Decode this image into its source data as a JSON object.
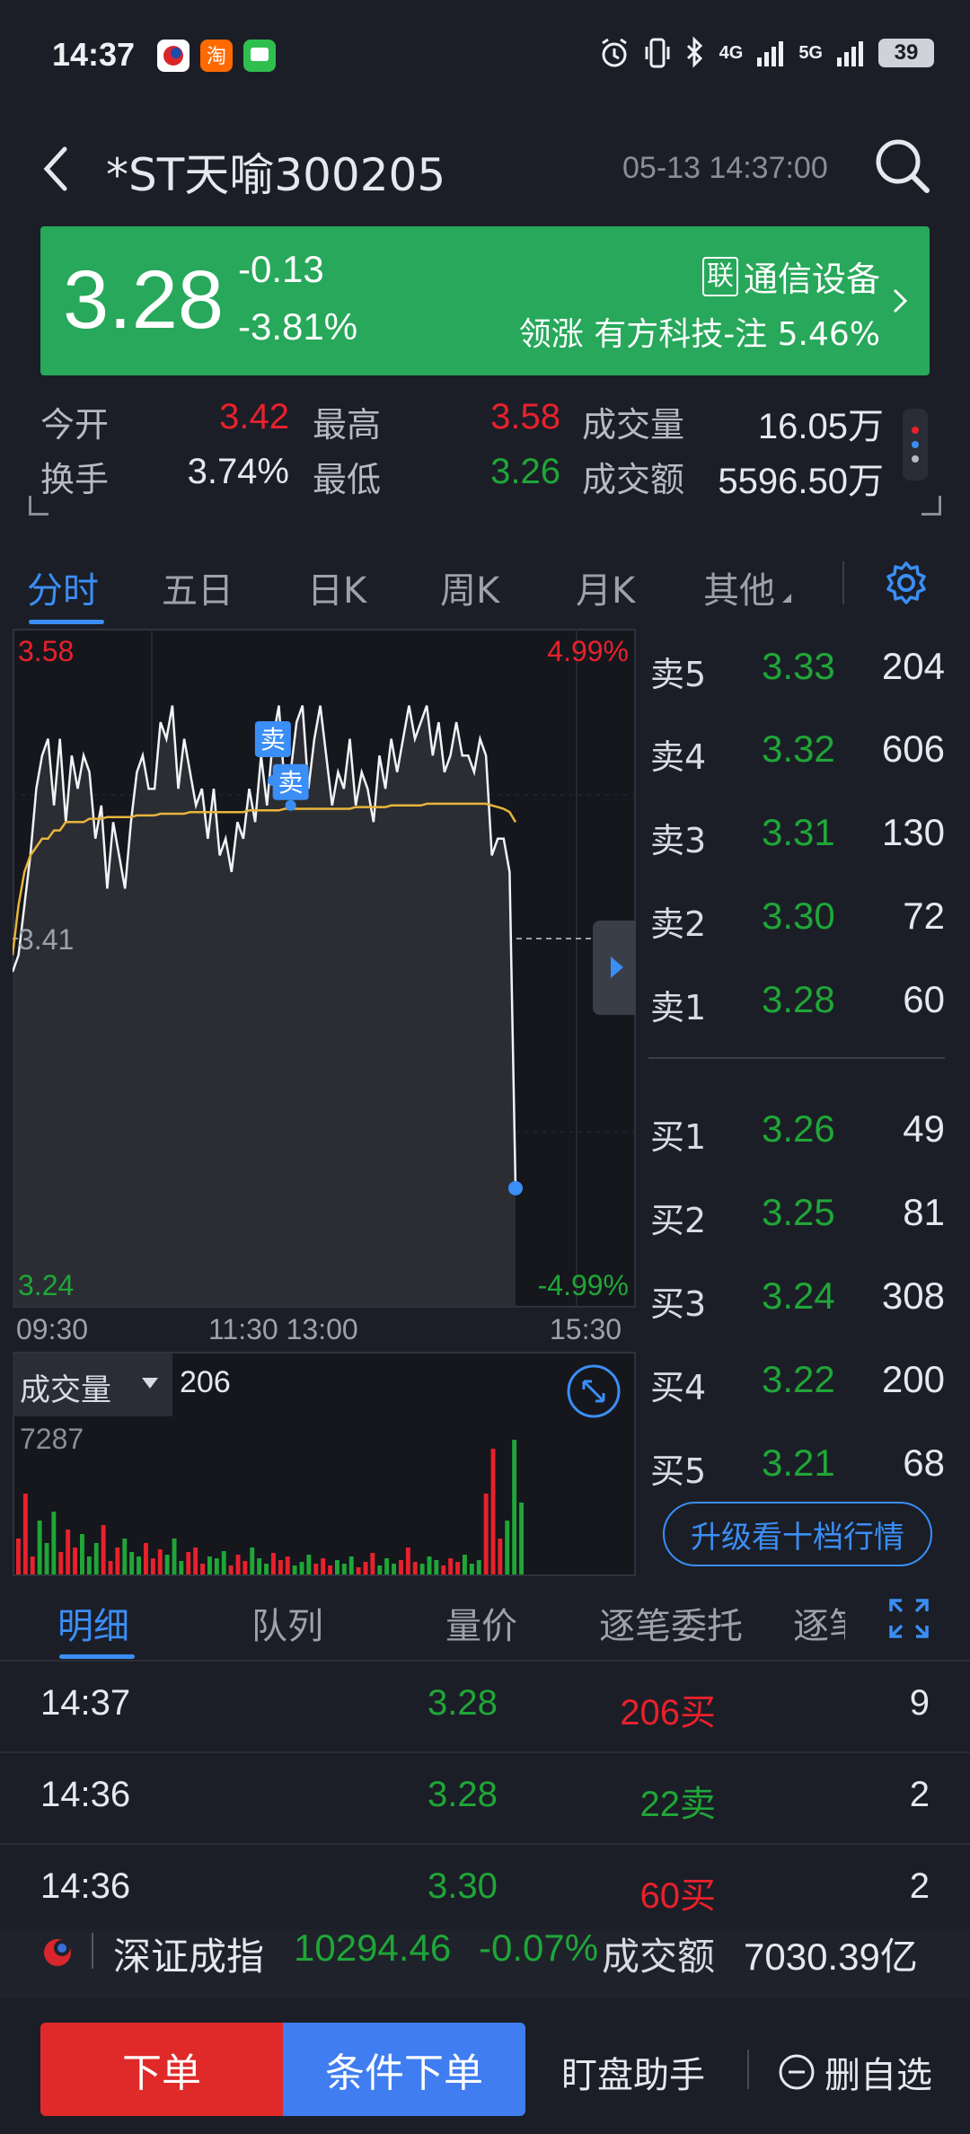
{
  "status_bar": {
    "time": "14:37",
    "battery": "39",
    "network_1": "4G",
    "network_2": "5G"
  },
  "header": {
    "title": "*ST天喻300205",
    "datetime": "05-13 14:37:00"
  },
  "banner": {
    "price": "3.28",
    "change": "-0.13",
    "change_pct": "-3.81%",
    "industry_tag": "联",
    "industry": "通信设备",
    "leader": "领涨 有方科技-注 5.46%"
  },
  "stats": {
    "open_label": "今开",
    "open": "3.42",
    "high_label": "最高",
    "high": "3.58",
    "volume_label": "成交量",
    "volume": "16.05万",
    "turnover_label": "换手",
    "turnover": "3.74%",
    "low_label": "最低",
    "low": "3.26",
    "amount_label": "成交额",
    "amount": "5596.50万"
  },
  "tabs": [
    "分时",
    "五日",
    "日K",
    "周K",
    "月K",
    "其他"
  ],
  "chart_data": {
    "type": "line",
    "title": "",
    "y_top_label": "3.58",
    "y_bottom_label": "3.24",
    "y_mid_label": "3.41",
    "pct_top": "4.99%",
    "pct_bottom": "-4.99%",
    "ylim": [
      3.24,
      3.58
    ],
    "prev_close": 3.41,
    "x_labels": [
      "09:30",
      "11:30 13:00",
      "15:30"
    ],
    "series": [
      {
        "values": [
          3.39,
          3.4,
          3.43,
          3.46,
          3.5,
          3.52,
          3.53,
          3.49,
          3.53,
          3.48,
          3.52,
          3.5,
          3.52,
          3.51,
          3.47,
          3.49,
          3.44,
          3.48,
          3.46,
          3.44,
          3.48,
          3.51,
          3.52,
          3.5,
          3.5,
          3.54,
          3.53,
          3.55,
          3.5,
          3.53,
          3.51,
          3.49,
          3.5,
          3.47,
          3.5,
          3.46,
          3.47,
          3.45,
          3.48,
          3.47,
          3.5,
          3.48,
          3.52,
          3.49,
          3.53,
          3.55,
          3.5,
          3.51,
          3.54,
          3.55,
          3.5,
          3.53,
          3.55,
          3.52,
          3.49,
          3.51,
          3.5,
          3.53,
          3.49,
          3.51,
          3.5,
          3.48,
          3.52,
          3.5,
          3.53,
          3.51,
          3.53,
          3.55,
          3.53,
          3.54,
          3.55,
          3.52,
          3.54,
          3.51,
          3.52,
          3.54,
          3.52,
          3.52,
          3.51,
          3.53,
          3.52,
          3.46,
          3.47,
          3.47,
          3.45,
          3.26
        ]
      },
      {
        "values": [
          3.4,
          3.43,
          3.45,
          3.46,
          3.465,
          3.47,
          3.47,
          3.475,
          3.475,
          3.48,
          3.48,
          3.48,
          3.48,
          3.482,
          3.482,
          3.482,
          3.483,
          3.483,
          3.483,
          3.483,
          3.483,
          3.484,
          3.484,
          3.484,
          3.484,
          3.485,
          3.485,
          3.485,
          3.485,
          3.485,
          3.486,
          3.486,
          3.486,
          3.486,
          3.486,
          3.486,
          3.486,
          3.486,
          3.486,
          3.486,
          3.487,
          3.487,
          3.487,
          3.487,
          3.487,
          3.487,
          3.488,
          3.488,
          3.488,
          3.488,
          3.488,
          3.488,
          3.488,
          3.488,
          3.488,
          3.488,
          3.488,
          3.488,
          3.489,
          3.489,
          3.489,
          3.489,
          3.489,
          3.489,
          3.49,
          3.49,
          3.49,
          3.49,
          3.49,
          3.49,
          3.491,
          3.491,
          3.491,
          3.491,
          3.491,
          3.491,
          3.491,
          3.491,
          3.491,
          3.491,
          3.491,
          3.49,
          3.489,
          3.488,
          3.486,
          3.48
        ]
      }
    ],
    "sell_markers": [
      "卖",
      "卖"
    ]
  },
  "volume_panel": {
    "label": "成交量",
    "current": "206",
    "max": "7287"
  },
  "order_book": {
    "sell": [
      {
        "label": "卖5",
        "price": "3.33",
        "vol": "204"
      },
      {
        "label": "卖4",
        "price": "3.32",
        "vol": "606"
      },
      {
        "label": "卖3",
        "price": "3.31",
        "vol": "130"
      },
      {
        "label": "卖2",
        "price": "3.30",
        "vol": "72"
      },
      {
        "label": "卖1",
        "price": "3.28",
        "vol": "60"
      }
    ],
    "buy": [
      {
        "label": "买1",
        "price": "3.26",
        "vol": "49"
      },
      {
        "label": "买2",
        "price": "3.25",
        "vol": "81"
      },
      {
        "label": "买3",
        "price": "3.24",
        "vol": "308"
      },
      {
        "label": "买4",
        "price": "3.22",
        "vol": "200"
      },
      {
        "label": "买5",
        "price": "3.21",
        "vol": "68"
      }
    ],
    "upgrade_label": "升级看十档行情"
  },
  "detail_tabs": [
    "明细",
    "队列",
    "量价",
    "逐笔委托",
    "逐笔"
  ],
  "trades": [
    {
      "time": "14:37",
      "price": "3.28",
      "vol": "206买",
      "side": "buy",
      "count": "9"
    },
    {
      "time": "14:36",
      "price": "3.28",
      "vol": "22卖",
      "side": "sell",
      "count": "2"
    },
    {
      "time": "14:36",
      "price": "3.30",
      "vol": "60买",
      "side": "buy",
      "count": "2"
    }
  ],
  "ticker": {
    "name": "深证成指",
    "value": "10294.46",
    "pct": "-0.07%",
    "amount_label": "成交额",
    "amount": "7030.39亿"
  },
  "bottom_bar": {
    "order": "下单",
    "conditional_order": "条件下单",
    "helper": "盯盘助手",
    "remove": "删自选"
  },
  "colors": {
    "up": "#e8212c",
    "down": "#1fa637",
    "accent": "#3b8ef5",
    "banner": "#27a85a"
  }
}
